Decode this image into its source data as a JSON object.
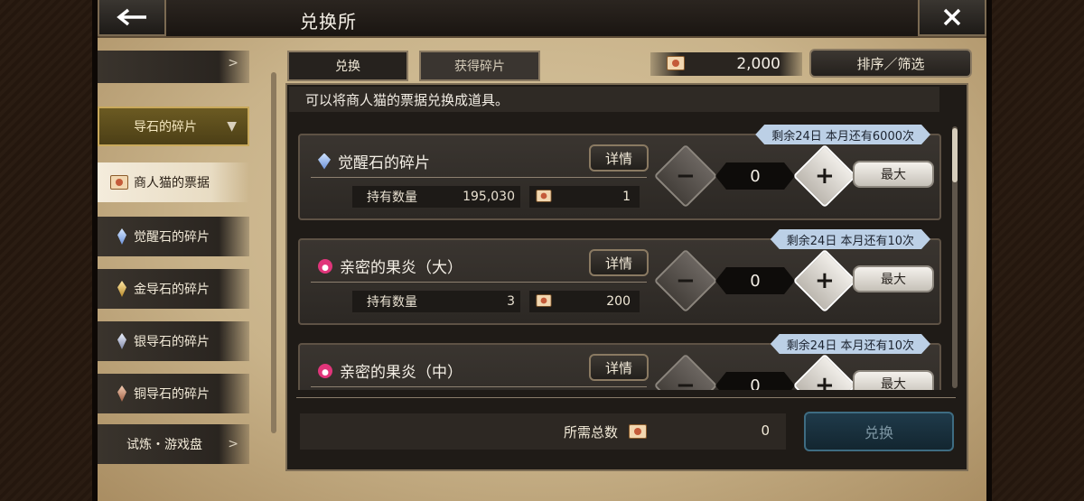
{
  "header": {
    "title": "兑换所"
  },
  "sidebar": {
    "items": [
      {
        "label": "",
        "icon": "none"
      },
      {
        "label": "导石的碎片",
        "icon": "chevron-down-icon"
      },
      {
        "label": "商人猫的票据",
        "icon": "ticket-icon"
      },
      {
        "label": "觉醒石的碎片",
        "icon": "crystal-icon"
      },
      {
        "label": "金导石的碎片",
        "icon": "gold-crystal-icon"
      },
      {
        "label": "银导石的碎片",
        "icon": "silver-crystal-icon"
      },
      {
        "label": "铜导石的碎片",
        "icon": "bronze-crystal-icon"
      },
      {
        "label": "试炼・游戏盘",
        "icon": "chevron-right-icon"
      }
    ]
  },
  "tabs": [
    {
      "label": "兑换"
    },
    {
      "label": "获得碎片"
    }
  ],
  "currency": {
    "value": "2,000"
  },
  "sort_label": "排序／筛选",
  "description": "可以将商人猫的票据兑换成道具。",
  "rows": [
    {
      "badge": "剩余24日 本月还有6000次",
      "name": "觉醒石的碎片",
      "detail": "详情",
      "holding_label": "持有数量",
      "holding": "195,030",
      "cost": "1",
      "qty": "0",
      "max": "最大"
    },
    {
      "badge": "剩余24日 本月还有10次",
      "name": "亲密的果炎（大）",
      "detail": "详情",
      "holding_label": "持有数量",
      "holding": "3",
      "cost": "200",
      "qty": "0",
      "max": "最大"
    },
    {
      "badge": "剩余24日 本月还有10次",
      "name": "亲密的果炎（中）",
      "detail": "详情",
      "holding_label": "持有数量",
      "holding": "",
      "cost": "",
      "qty": "0",
      "max": "最大"
    }
  ],
  "footer": {
    "total_label": "所需总数",
    "total_value": "0",
    "exchange_label": "兑换"
  },
  "colors": {
    "badge": "#bcd0e6",
    "exchange_button": "#1f3a4a",
    "sidebar_gold": "#6b5a22"
  }
}
